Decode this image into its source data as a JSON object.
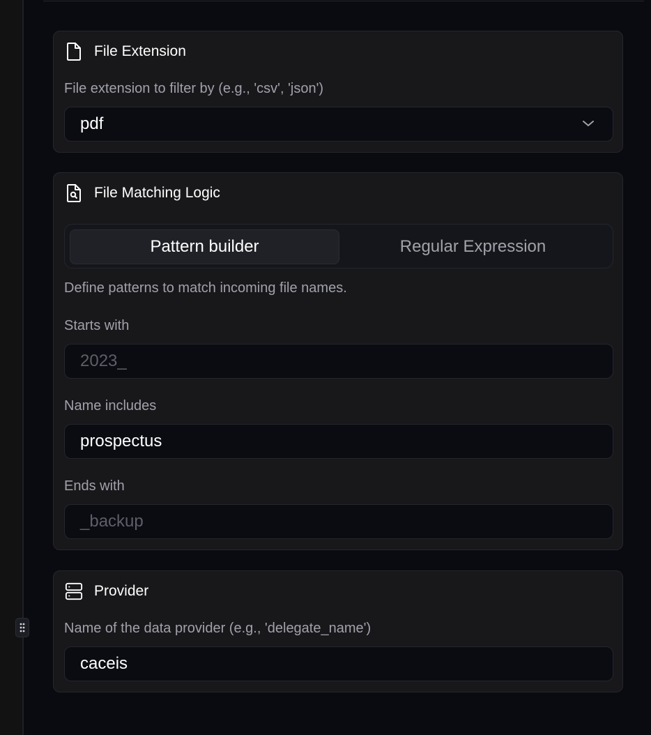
{
  "file_extension": {
    "title": "File Extension",
    "icon": "file-icon",
    "label": "File extension to filter by (e.g., 'csv', 'json')",
    "value": "pdf"
  },
  "file_matching": {
    "title": "File Matching Logic",
    "icon": "file-search-icon",
    "tabs": [
      {
        "label": "Pattern builder",
        "active": true
      },
      {
        "label": "Regular Expression",
        "active": false
      }
    ],
    "description": "Define patterns to match incoming file names.",
    "starts_with": {
      "label": "Starts with",
      "value": "",
      "placeholder": "2023_"
    },
    "name_includes": {
      "label": "Name includes",
      "value": "prospectus"
    },
    "ends_with": {
      "label": "Ends with",
      "value": "",
      "placeholder": "_backup"
    }
  },
  "provider": {
    "title": "Provider",
    "icon": "server-icon",
    "label": "Name of the data provider (e.g., 'delegate_name')",
    "value": "caceis"
  },
  "colors": {
    "background": "#0a0b10",
    "card": "#18181b",
    "input": "#0b0c12",
    "muted_text": "#a1a1aa",
    "placeholder_text": "#5d5f68"
  }
}
